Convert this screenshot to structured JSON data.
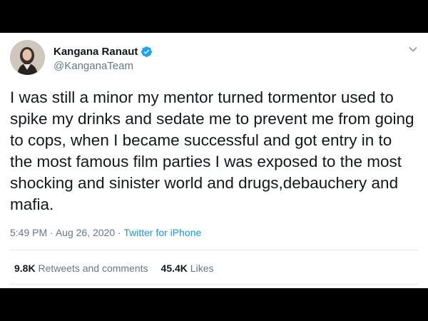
{
  "tweet": {
    "author": {
      "display_name": "Kangana Ranaut",
      "handle": "@KanganaTeam",
      "verified": true
    },
    "text": "I was still a minor my mentor turned tormentor used to spike my drinks and sedate me to prevent me from going to cops, when I became successful and got entry in to the most famous film parties I was exposed to the most shocking and sinister world and drugs,debauchery and mafia.",
    "time": "5:49 PM",
    "separator": "·",
    "date": "Aug 26, 2020",
    "source": "Twitter for iPhone",
    "stats": {
      "retweets_count": "9.8K",
      "retweets_label": "Retweets and comments",
      "likes_count": "45.4K",
      "likes_label": "Likes"
    }
  },
  "icons": {
    "verified": "verified-badge-icon",
    "menu": "chevron-down-icon"
  },
  "colors": {
    "background_frame": "#000000",
    "card": "#ffffff",
    "text_primary": "#14171a",
    "text_secondary": "#657786",
    "link": "#1b95e0",
    "verified_blue": "#1da1f2",
    "divider": "#e6ecf0"
  }
}
